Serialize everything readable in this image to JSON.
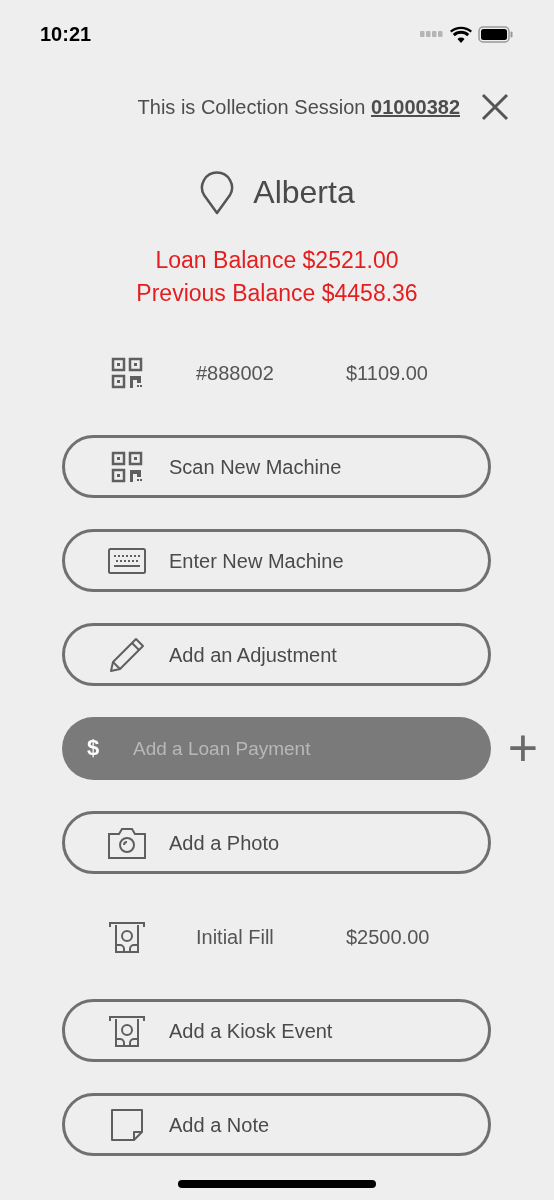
{
  "status_bar": {
    "time": "10:21"
  },
  "header": {
    "session_text": "This is Collection Session",
    "session_number": "01000382"
  },
  "location": {
    "name": "Alberta"
  },
  "balances": [
    "Loan Balance $2521.00",
    "Previous Balance $4458.36"
  ],
  "items": [
    {
      "kind": "entry",
      "label": "#888002",
      "amount": "$1109.00"
    },
    {
      "kind": "button",
      "label": "Scan New Machine"
    },
    {
      "kind": "button",
      "label": "Enter New Machine"
    },
    {
      "kind": "button",
      "label": "Add an Adjustment"
    },
    {
      "kind": "field",
      "placeholder": "Add a Loan Payment",
      "symbol": "$",
      "add": "+"
    },
    {
      "kind": "button",
      "label": "Add a Photo"
    },
    {
      "kind": "entry",
      "label": "Initial Fill",
      "amount": "$2500.00"
    },
    {
      "kind": "button",
      "label": "Add a Kiosk Event"
    },
    {
      "kind": "button",
      "label": "Add a Note"
    }
  ]
}
